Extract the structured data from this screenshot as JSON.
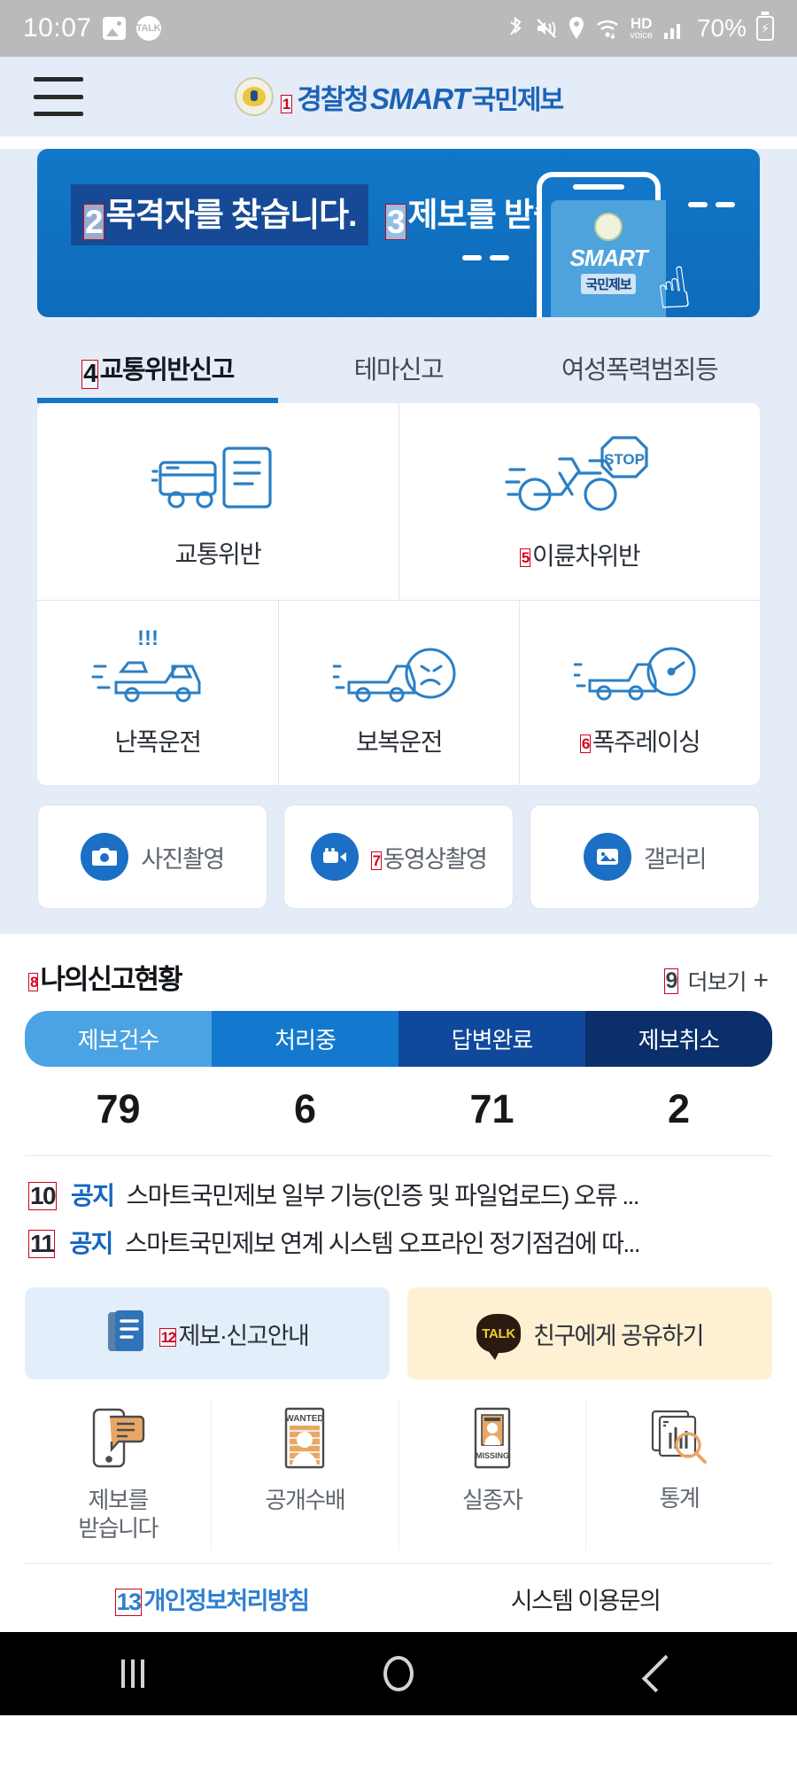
{
  "statusbar": {
    "time": "10:07",
    "battery_percent": "70%",
    "icons": [
      "gallery-icon",
      "kakaotalk-icon",
      "bluetooth-icon",
      "mute-vibrate-icon",
      "location-icon",
      "wifi-icon",
      "hd-voice-icon",
      "signal-icon"
    ],
    "hd_main": "HD",
    "hd_sub": "voice"
  },
  "header": {
    "menu_icon": "hamburger-menu-icon",
    "logo_emblem": "police-emblem-icon",
    "logo_prefix": "경찰청",
    "logo_brand": "SMART",
    "logo_suffix": "국민제보",
    "marker": "1"
  },
  "banner": {
    "line1": "목격자를 찾습니다.",
    "line2": "제보를 받습니다.",
    "marker1": "2",
    "marker2": "3",
    "phone_brand": "SMART",
    "phone_sub": "국민제보",
    "hand_icon": "pointing-hand-icon"
  },
  "tabs": [
    {
      "label": "교통위반신고",
      "active": true,
      "marker": "4"
    },
    {
      "label": "테마신고",
      "active": false
    },
    {
      "label": "여성폭력범죄등",
      "active": false
    }
  ],
  "report_grid": {
    "row1": [
      {
        "label": "교통위반",
        "icon": "truck-document-icon"
      },
      {
        "label": "이륜차위반",
        "icon": "motorcycle-stop-sign-icon",
        "marker": "5"
      }
    ],
    "row2": [
      {
        "label": "난폭운전",
        "icon": "reckless-driving-icon"
      },
      {
        "label": "보복운전",
        "icon": "road-rage-angry-face-icon"
      },
      {
        "label": "폭주레이싱",
        "icon": "speeding-race-icon",
        "marker": "6"
      }
    ]
  },
  "capture_buttons": [
    {
      "label": "사진촬영",
      "icon": "camera-icon"
    },
    {
      "label": "동영상촬영",
      "icon": "video-camera-icon",
      "marker": "7"
    },
    {
      "label": "갤러리",
      "icon": "gallery-image-icon"
    }
  ],
  "my_reports": {
    "title": "나의신고현황",
    "title_marker": "8",
    "more_label": "더보기",
    "more_icon": "plus-icon",
    "more_marker": "9",
    "stats": [
      {
        "label": "제보건수",
        "value": "79",
        "color": "#4ba3e3"
      },
      {
        "label": "처리중",
        "value": "6",
        "color": "#1279ce"
      },
      {
        "label": "답변완료",
        "value": "71",
        "color": "#10499c"
      },
      {
        "label": "제보취소",
        "value": "2",
        "color": "#0a2f6b"
      }
    ]
  },
  "notices": [
    {
      "tag": "공지",
      "text": "스마트국민제보 일부 기능(인증 및 파일업로드) 오류 ...",
      "marker": "10"
    },
    {
      "tag": "공지",
      "text": "스마트국민제보 연계 시스템 오프라인 정기점검에 따...",
      "marker": "11"
    }
  ],
  "promos": [
    {
      "label": "제보·신고안내",
      "icon": "guide-book-icon",
      "marker": "12"
    },
    {
      "label": "친구에게 공유하기",
      "icon": "kakaotalk-icon",
      "kakao_text": "TALK"
    }
  ],
  "quick_links": [
    {
      "label": "제보를\n받습니다",
      "icon": "phone-message-icon"
    },
    {
      "label": "공개수배",
      "icon": "wanted-poster-icon",
      "poster_text": "WANTED"
    },
    {
      "label": "실종자",
      "icon": "missing-person-icon",
      "poster_text": "MISSING"
    },
    {
      "label": "통계",
      "icon": "statistics-search-icon"
    }
  ],
  "footer": {
    "privacy_label": "개인정보처리방침",
    "privacy_marker": "13",
    "inquiry_label": "시스템 이용문의"
  },
  "navbar": {
    "recents": "recents-icon",
    "home": "home-icon",
    "back": "back-icon"
  },
  "colors": {
    "brand_blue": "#1b63b5",
    "banner_blue": "#1277c8",
    "page_blue": "#e4ecf7",
    "marker_red": "#d0021b",
    "notice_blue": "#1565c0"
  }
}
